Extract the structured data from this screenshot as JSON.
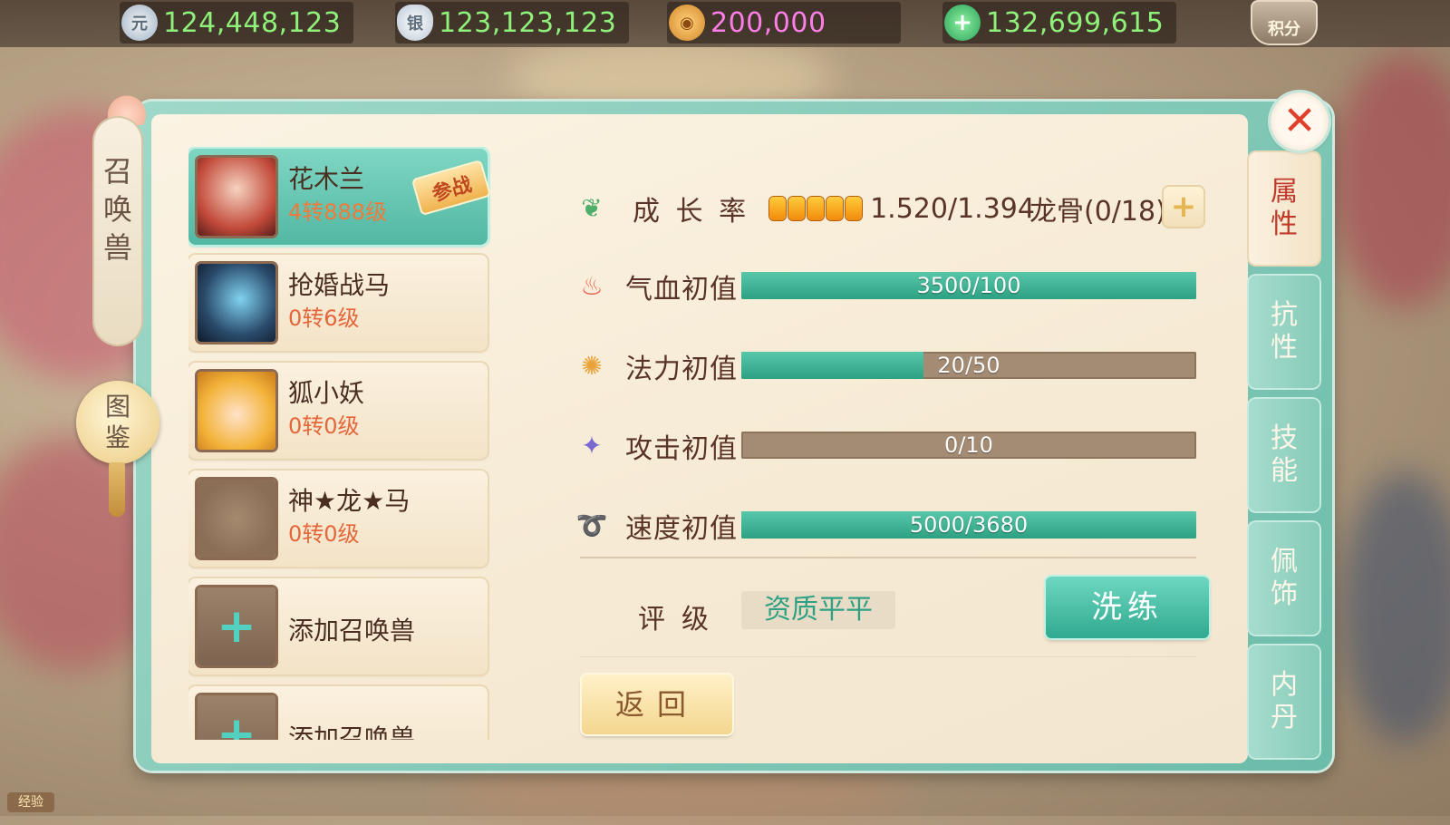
{
  "currencies": [
    {
      "icon": "yuanbao-coin-icon",
      "icon_glyph": "元",
      "value": "124,448,123",
      "color": "#8ff07a"
    },
    {
      "icon": "silver-ingot-icon",
      "icon_glyph": "银",
      "value": "123,123,123",
      "color": "#8ff07a"
    },
    {
      "icon": "copper-coin-icon",
      "icon_glyph": "◉",
      "value": "200,000",
      "color": "#ff7ee8"
    },
    {
      "icon": "jade-plus-icon",
      "icon_glyph": "+",
      "value": "132,699,615",
      "color": "#8ff07a"
    }
  ],
  "score_badge": "积分",
  "left_title": [
    "召",
    "唤",
    "兽"
  ],
  "catalog_button": [
    "图",
    "鉴"
  ],
  "pets": [
    {
      "name": "花木兰",
      "level": "4转888级",
      "active": true,
      "battle_tag": "参战"
    },
    {
      "name": "抢婚战马",
      "level": "0转6级",
      "active": false
    },
    {
      "name": "狐小妖",
      "level": "0转0级",
      "active": false
    },
    {
      "name": "神★龙★马",
      "level": "0转0级",
      "active": false
    },
    {
      "add_label": "添加召唤兽"
    },
    {
      "add_label": "添加召唤兽"
    }
  ],
  "growth": {
    "label": "成 长 率",
    "pips": 5,
    "value": "1.520/1.394",
    "dragon_bone": "龙骨(0/18)"
  },
  "stats": [
    {
      "label": "气血初值",
      "text": "3500/100",
      "fill": 1.0,
      "icon": "blood-drop-icon",
      "glyph": "♨"
    },
    {
      "label": "法力初值",
      "text": "20/50",
      "fill": 0.4,
      "icon": "mana-swirl-icon",
      "glyph": "✺"
    },
    {
      "label": "攻击初值",
      "text": "0/10",
      "fill": 0.0,
      "icon": "sword-icon",
      "glyph": "✦"
    },
    {
      "label": "速度初值",
      "text": "5000/3680",
      "fill": 1.0,
      "icon": "wind-speed-icon",
      "glyph": "➰"
    }
  ],
  "rating": {
    "label": "评级",
    "value": "资质平平"
  },
  "refine_button": "洗练",
  "back_button": "返回",
  "tabs": [
    {
      "chars": [
        "属",
        "性"
      ],
      "active": true
    },
    {
      "chars": [
        "抗",
        "性"
      ],
      "active": false
    },
    {
      "chars": [
        "技",
        "能"
      ],
      "active": false
    },
    {
      "chars": [
        "佩",
        "饰"
      ],
      "active": false
    },
    {
      "chars": [
        "内",
        "丹"
      ],
      "active": false
    }
  ],
  "close_glyph": "✕",
  "exp_badge": "经验",
  "colors": {
    "accent_teal": "#2ea183",
    "text_brown": "#5a3426",
    "level_orange": "#e3673a",
    "close_red": "#e0402b"
  }
}
